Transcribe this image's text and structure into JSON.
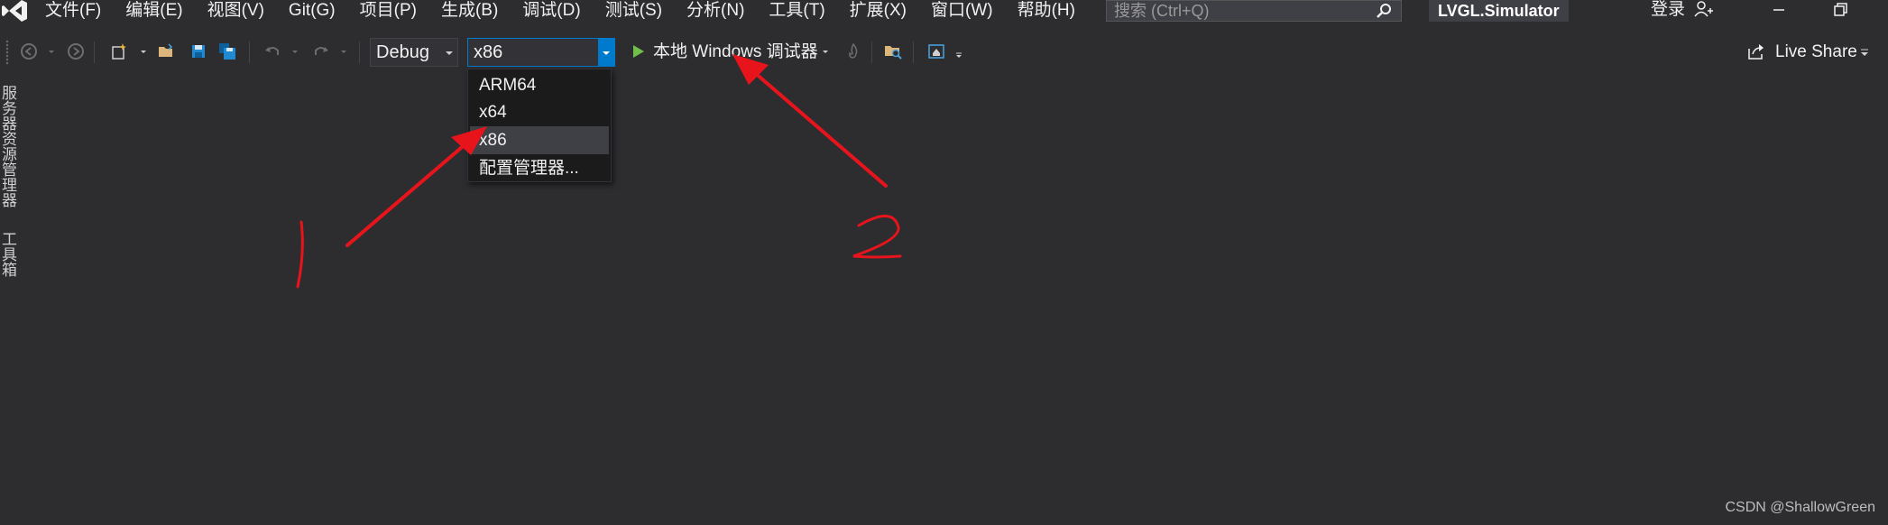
{
  "menubar": {
    "items": [
      "文件(F)",
      "编辑(E)",
      "视图(V)",
      "Git(G)",
      "项目(P)",
      "生成(B)",
      "调试(D)",
      "测试(S)",
      "分析(N)",
      "工具(T)",
      "扩展(X)",
      "窗口(W)",
      "帮助(H)"
    ],
    "search_placeholder": "搜索 (Ctrl+Q)",
    "solution_name": "LVGL.Simulator",
    "login_label": "登录"
  },
  "toolbar": {
    "configuration": "Debug",
    "platform": "x86",
    "run_target": "本地 Windows 调试器",
    "live_share": "Live Share"
  },
  "platform_dropdown": {
    "options": [
      "ARM64",
      "x64",
      "x86",
      "配置管理器..."
    ],
    "selected": "x86"
  },
  "side_tabs": [
    "服务器资源管理器",
    "工具箱"
  ],
  "annotations": {
    "label_1": "1",
    "label_2": "2",
    "color": "#e8141c"
  },
  "watermark": "CSDN @ShallowGreen",
  "colors": {
    "background": "#2d2d30",
    "accent": "#007acc",
    "run_green": "#6fbf4a"
  }
}
